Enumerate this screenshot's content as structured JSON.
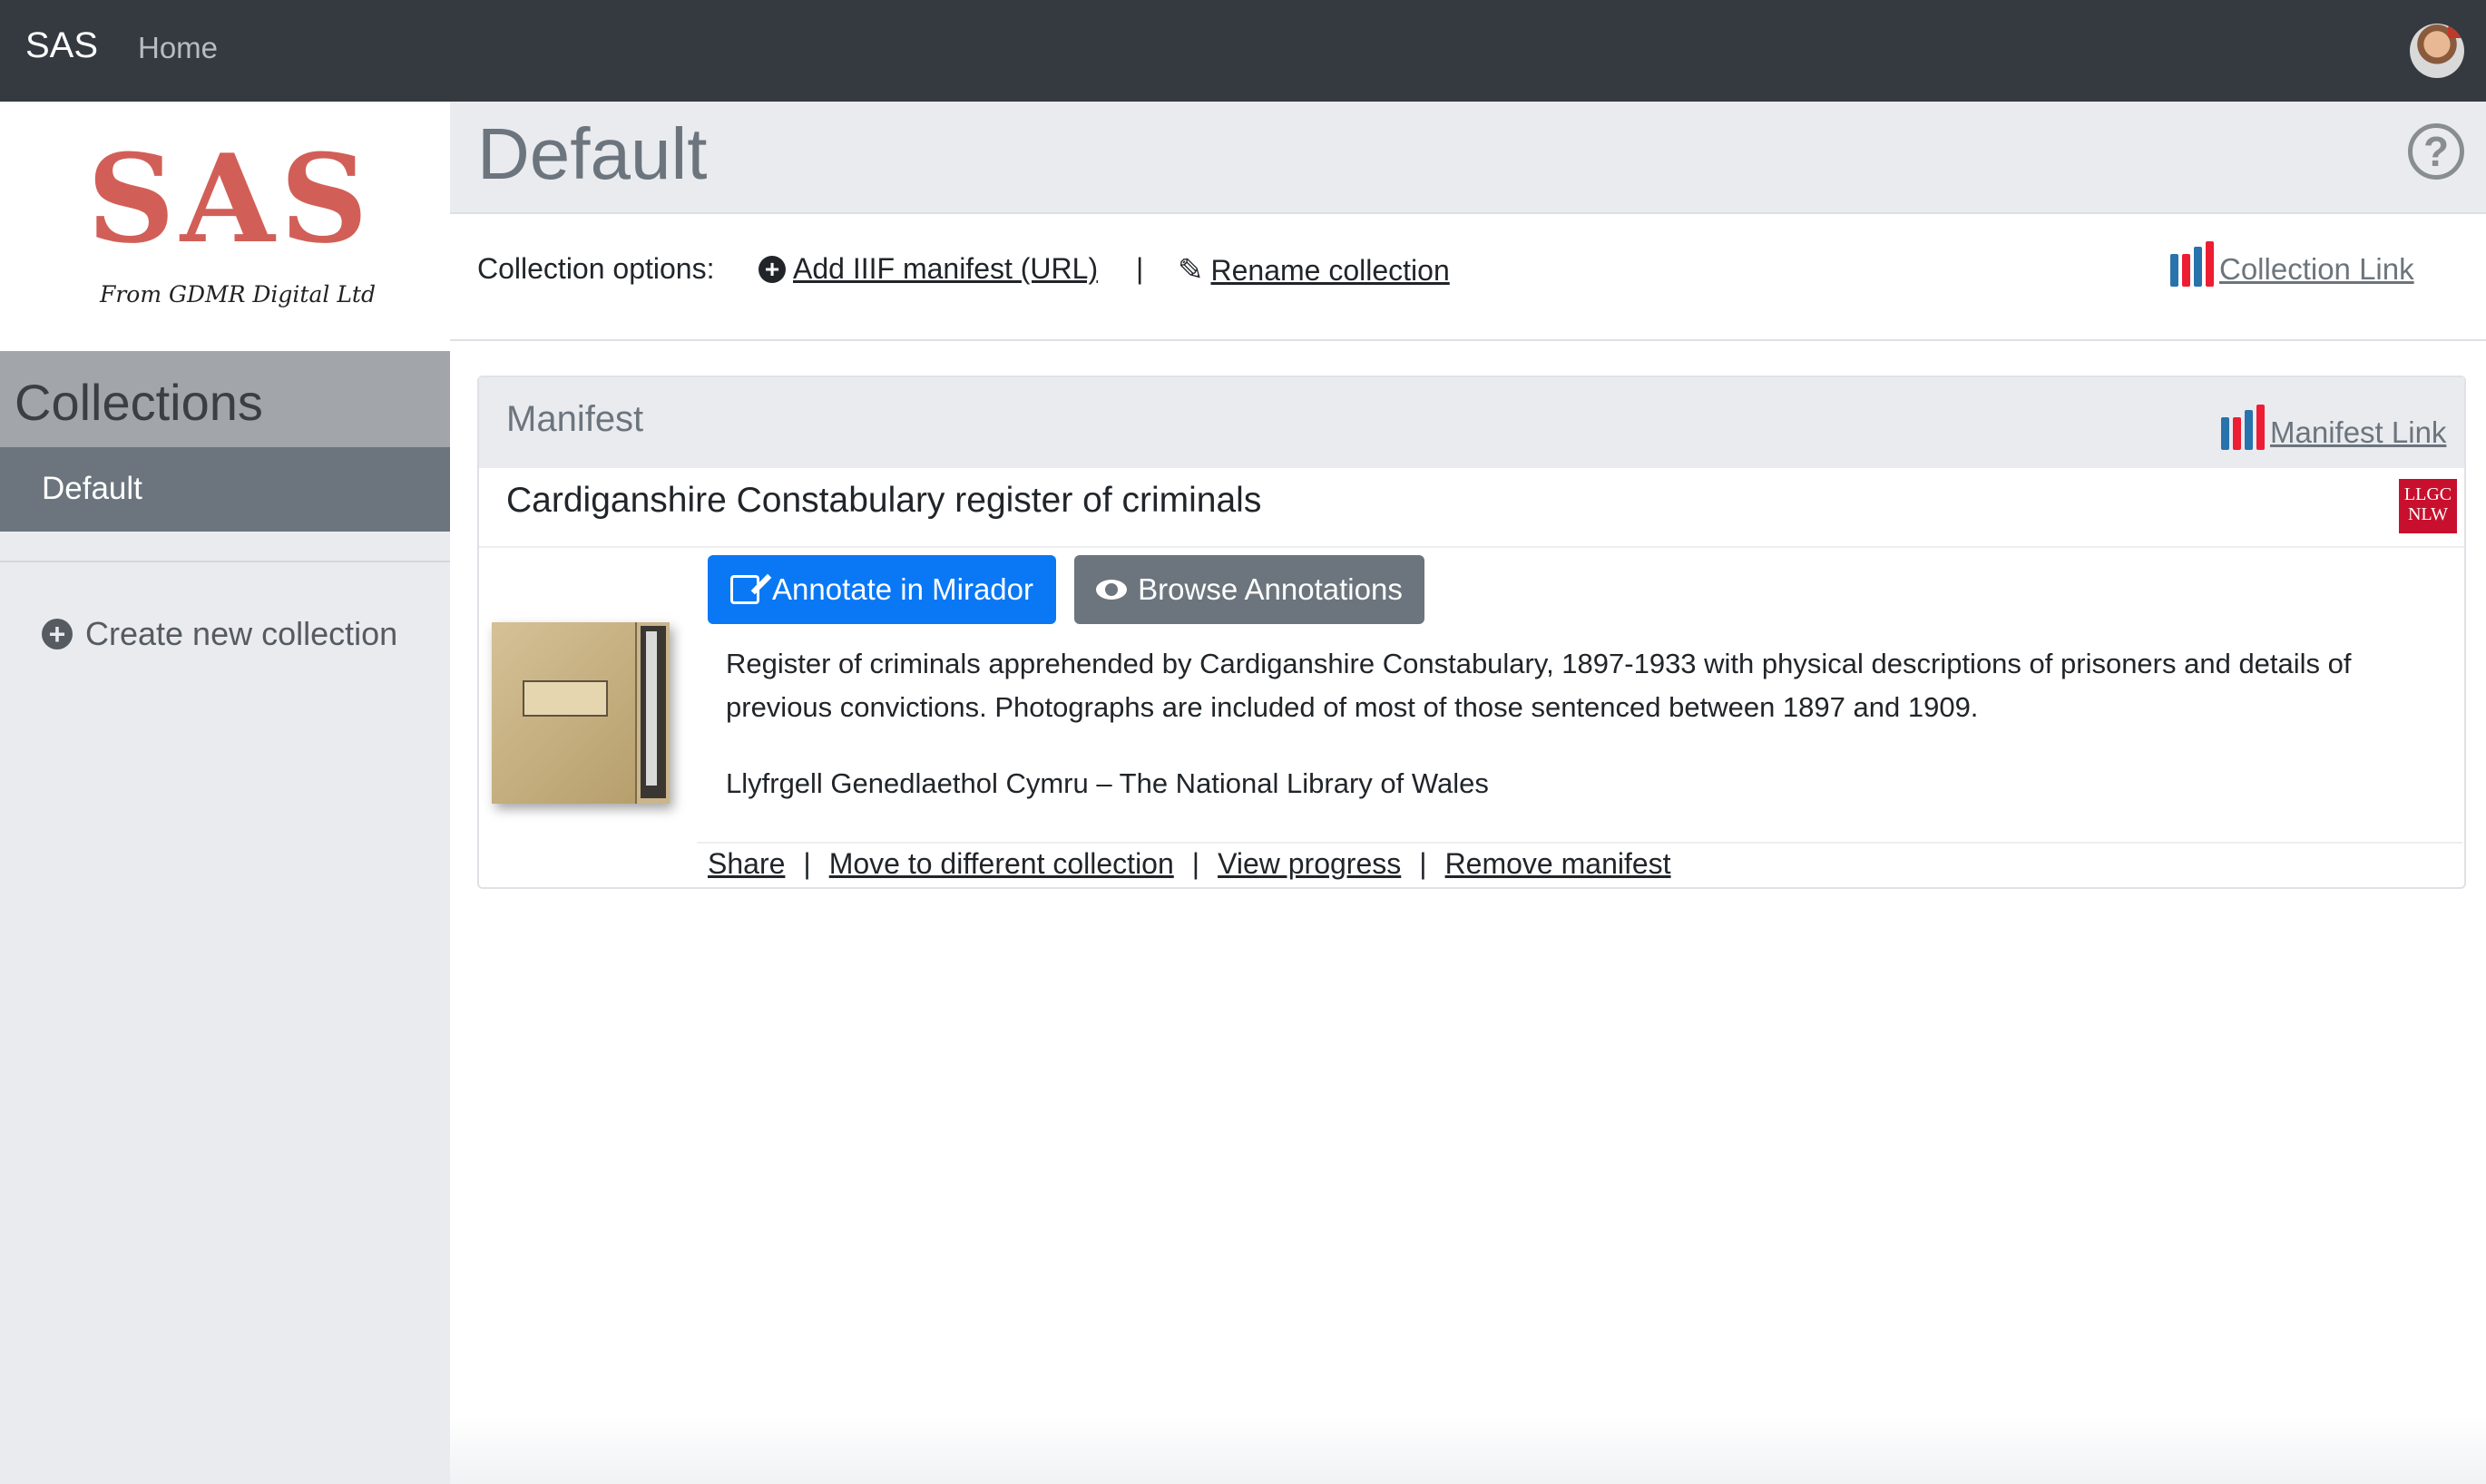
{
  "navbar": {
    "brand": "SAS",
    "home_label": "Home"
  },
  "sidebar": {
    "logo_text": "SAS",
    "logo_subtitle": "From GDMR Digital Ltd",
    "collections_heading": "Collections",
    "collections": [
      {
        "label": "Default",
        "active": true
      }
    ],
    "create_label": "Create new collection"
  },
  "page": {
    "title": "Default"
  },
  "options": {
    "label": "Collection options:",
    "add_manifest": "Add IIIF manifest (URL)",
    "separator": "|",
    "rename": "Rename collection",
    "collection_link": "Collection Link"
  },
  "manifest_card": {
    "header": "Manifest",
    "manifest_link": "Manifest Link",
    "title": "Cardiganshire Constabulary register of criminals",
    "provider_logo_line1": "LLGC",
    "provider_logo_line2": "NLW",
    "annotate_button": "Annotate in Mirador",
    "browse_button": "Browse Annotations",
    "description": "Register of criminals apprehended by Cardiganshire Constabulary, 1897-1933 with physical descriptions of prisoners and details of previous convictions. Photographs are included of most of those sentenced between 1897 and 1909.",
    "library": "Llyfrgell Genedlaethol Cymru – The National Library of Wales",
    "actions": {
      "share": "Share",
      "move": "Move to different collection",
      "progress": "View progress",
      "remove": "Remove manifest",
      "separator": "|"
    }
  },
  "colors": {
    "navbar_bg": "#343a40",
    "logo_red": "#d25f57",
    "primary_button": "#0a78f5",
    "secondary_button": "#6c757d",
    "nlw_red": "#c8102e"
  },
  "icons": {
    "add": "plus-circle-icon",
    "rename": "pencil-icon",
    "help": "question-circle-icon",
    "iiif": "iiif-logo-icon",
    "annotate": "edit-icon",
    "browse": "eye-icon"
  }
}
